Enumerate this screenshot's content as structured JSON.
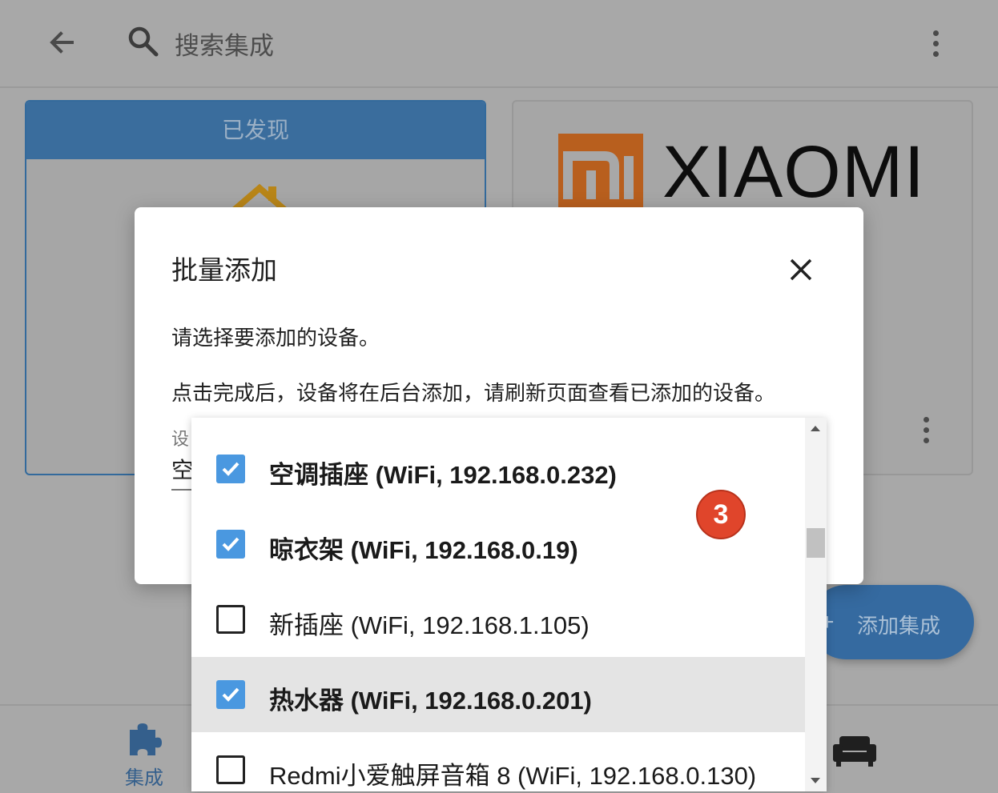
{
  "topbar": {
    "search_placeholder": "搜索集成"
  },
  "cards": {
    "discovered": {
      "header": "已发现"
    },
    "xiaomi": {
      "brand": "XIAOMI",
      "logo_text": "mi"
    }
  },
  "fab": {
    "icon": "+",
    "label": "添加集成"
  },
  "bottom_nav": {
    "integrations_label": "集成"
  },
  "dialog": {
    "title": "批量添加",
    "description_1": "请选择要添加的设备。",
    "description_2": "点击完成后，设备将在后台添加，请刷新页面查看已添加的设备。",
    "field_label": "设",
    "field_value": "空"
  },
  "dropdown": {
    "items": [
      {
        "label": "空调插座 (WiFi, 192.168.0.232)",
        "checked": true
      },
      {
        "label": "晾衣架 (WiFi, 192.168.0.19)",
        "checked": true
      },
      {
        "label": "新插座 (WiFi, 192.168.1.105)",
        "checked": false
      },
      {
        "label": "热水器 (WiFi, 192.168.0.201)",
        "checked": true
      },
      {
        "label": "Redmi小爱触屏音箱 8 (WiFi, 192.168.0.130)",
        "checked": false
      }
    ]
  },
  "step_badge": "3",
  "colors": {
    "accent": "#4a98e0",
    "primary_dim": "#3a6d9d",
    "badge": "#e0452b",
    "xiaomi_orange": "#b85f1e"
  }
}
